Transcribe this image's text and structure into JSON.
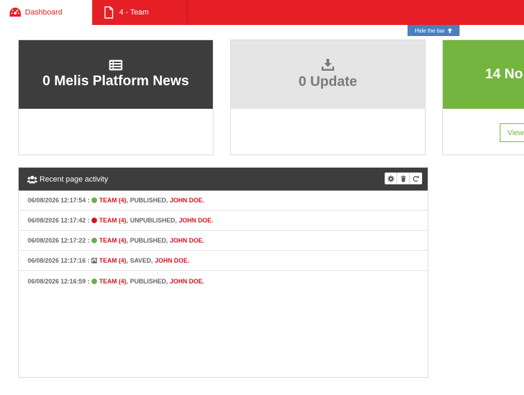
{
  "tabs": {
    "dashboard_label": "Dashboard",
    "team_label": "4 - Team"
  },
  "hide_bar_label": "Hide the bar",
  "cards": {
    "news_title": "0 Melis Platform News",
    "update_title": "0 Update",
    "notifications_title": "14 No",
    "view_button": "View"
  },
  "activity": {
    "title": "Recent page activity",
    "rows": [
      {
        "date": "06/08/2026 12:17:54 :",
        "status": "published",
        "page": "TEAM (4)",
        "action": "PUBLISHED,",
        "user": "JOHN DOE."
      },
      {
        "date": "06/08/2026 12:17:42 :",
        "status": "unpublished",
        "page": "TEAM (4)",
        "action": "UNPUBLISHED,",
        "user": "JOHN DOE."
      },
      {
        "date": "06/08/2026 12:17:22 :",
        "status": "published",
        "page": "TEAM (4)",
        "action": "PUBLISHED,",
        "user": "JOHN DOE."
      },
      {
        "date": "06/08/2026 12:17:16 :",
        "status": "saved",
        "page": "TEAM (4)",
        "action": "SAVED,",
        "user": "JOHN DOE."
      },
      {
        "date": "06/08/2026 12:16:59 :",
        "status": "published",
        "page": "TEAM (4)",
        "action": "PUBLISHED,",
        "user": "JOHN DOE."
      }
    ]
  },
  "colors": {
    "brand_red": "#e61e25",
    "dark": "#3d3d3d",
    "green": "#74b53f",
    "link_blue": "#4a7fc1",
    "status_published": "#6ab04c",
    "status_unpublished": "#d0161c"
  },
  "icons": {
    "dashboard": "speedometer-icon",
    "team_tab": "document-icon",
    "hide_bar": "arrow-up-icon",
    "news": "newspaper-icon",
    "update": "download-icon",
    "activity": "users-icon",
    "tools": [
      "gear-icon",
      "trash-icon",
      "refresh-icon"
    ]
  }
}
